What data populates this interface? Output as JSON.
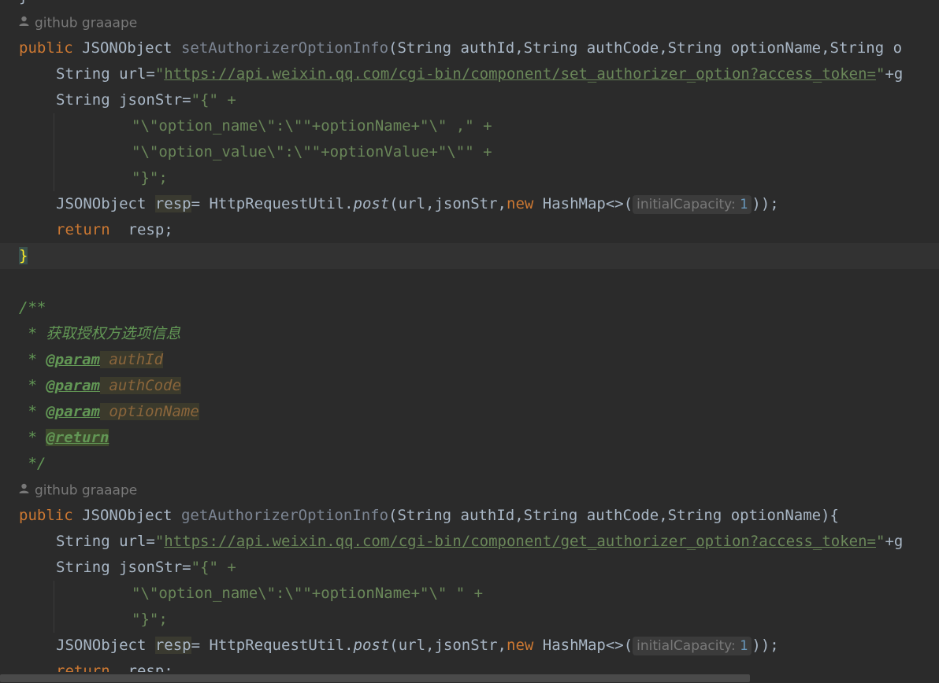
{
  "colors": {
    "background": "#2b2b2b",
    "keyword": "#cc7832",
    "string": "#6a8759",
    "comment": "#629755",
    "identifier": "#a9b7c6",
    "number": "#6897bb",
    "brace_highlight": "#ffef28"
  },
  "icons": {
    "author": "person-icon"
  },
  "authors": [
    "github graaape",
    "github graaape"
  ],
  "method1": {
    "kw_public": "public",
    "ret_type": "JSONObject",
    "name": "setAuthorizerOptionInfo",
    "params": "(String authId,String authCode,String optionName,String o",
    "url_prefix": "String url=",
    "url": "https://api.weixin.qq.com/cgi-bin/component/set_authorizer_option?access_token=",
    "url_suffix": "+g",
    "json_decl": "String jsonStr=",
    "json_open": "\"{\" +",
    "line_option_name": "\"\\\"option_name\\\":\\\"\"+optionName+\"\\\" ,\" +",
    "line_option_value": "\"\\\"option_value\\\":\\\"\"+optionValue+\"\\\"\" +",
    "line_close": "\"}\";",
    "resp_type": "JSONObject",
    "resp_var": "resp",
    "resp_assign": "= HttpRequestUtil.",
    "post": "post",
    "post_args": "(url,jsonStr,",
    "kw_new": "new",
    "hashmap": " HashMap<>(",
    "hint_label": "initialCapacity:",
    "hint_value": "1",
    "call_end": "));",
    "kw_return": "return",
    "return_val": "  resp;",
    "close_brace": "}"
  },
  "javadoc": {
    "open": "/**",
    "desc": " * 获取授权方选项信息",
    "star": " * ",
    "param_tag": "@param",
    "params": [
      "authId",
      "authCode",
      "optionName"
    ],
    "return_tag": "@return",
    "close": " */"
  },
  "method2": {
    "kw_public": "public",
    "ret_type": "JSONObject",
    "name": "getAuthorizerOptionInfo",
    "params": "(String authId,String authCode,String optionName){",
    "url_prefix": "String url=",
    "url": "https://api.weixin.qq.com/cgi-bin/component/get_authorizer_option?access_token=",
    "url_suffix": "+g",
    "json_decl": "String jsonStr=",
    "json_open": "\"{\" +",
    "line_option_name": "\"\\\"option_name\\\":\\\"\"+optionName+\"\\\" \" +",
    "line_close": "\"}\";",
    "resp_type": "JSONObject",
    "resp_var": "resp",
    "resp_assign": "= HttpRequestUtil.",
    "post": "post",
    "post_args": "(url,jsonStr,",
    "kw_new": "new",
    "hashmap": " HashMap<>(",
    "hint_label": "initialCapacity:",
    "hint_value": "1",
    "call_end": "));",
    "kw_return": "return",
    "return_val": "  resp;"
  }
}
